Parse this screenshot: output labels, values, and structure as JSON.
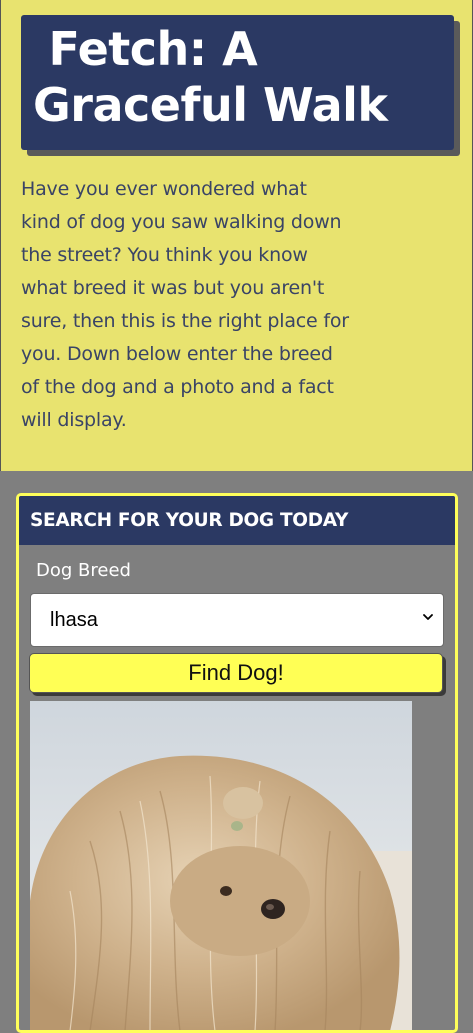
{
  "hero": {
    "title": " Fetch: A\nGraceful Walk",
    "intro": "Have you ever wondered what kind of dog you saw walking down the street? You think you know what breed it was but you aren't sure, then this is the right place for you. Down below enter the breed of the dog and a photo and a fact will display."
  },
  "search": {
    "header": "SEARCH FOR YOUR DOG TODAY",
    "breed_label": "Dog Breed",
    "selected_breed": "lhasa",
    "button_label": "Find Dog!"
  },
  "colors": {
    "hero_bg": "#e8e36f",
    "navy": "#2b3963",
    "card_border": "#ffff5a",
    "button_bg": "#ffff55",
    "page_bg": "#7f7f7f"
  },
  "result": {
    "image": "photo of a long-haired fawn lhasa dog with topknot"
  }
}
